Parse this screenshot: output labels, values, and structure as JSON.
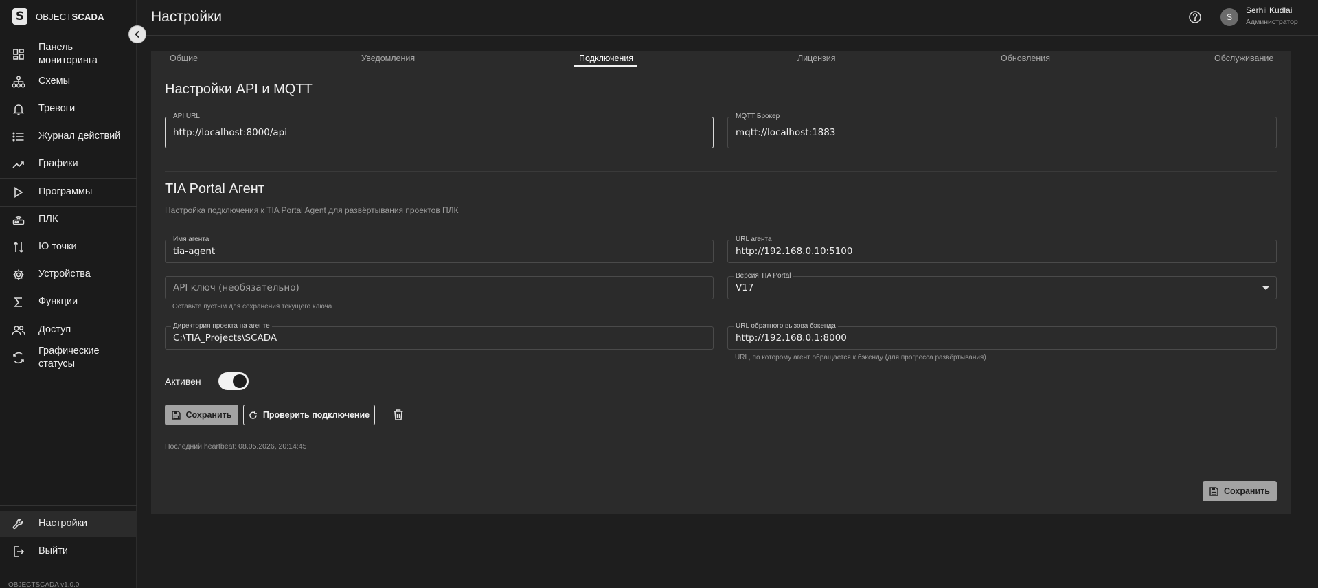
{
  "app": {
    "logo_text_light": "OBJECT",
    "logo_text_bold": "SCADA",
    "version": "OBJECTSCADA v1.0.0"
  },
  "sidebar": {
    "items": [
      {
        "label_line1": "Панель",
        "label_line2": "мониторинга",
        "icon": "dashboard-icon"
      },
      {
        "label": "Схемы",
        "icon": "schema-icon"
      },
      {
        "label": "Тревоги",
        "icon": "bell-icon"
      },
      {
        "label": "Журнал действий",
        "icon": "list-icon"
      },
      {
        "label": "Графики",
        "icon": "trend-icon"
      },
      {
        "label": "Программы",
        "icon": "play-icon"
      },
      {
        "label": "ПЛК",
        "icon": "router-icon"
      },
      {
        "label": "IO точки",
        "icon": "io-icon"
      },
      {
        "label": "Устройства",
        "icon": "gear-icon"
      },
      {
        "label": "Функции",
        "icon": "sigma-icon"
      },
      {
        "label": "Доступ",
        "icon": "users-icon"
      },
      {
        "label_line1": "Графические",
        "label_line2": "статусы",
        "icon": "status-icon"
      }
    ],
    "bottom": [
      {
        "label": "Настройки",
        "icon": "wrench-icon"
      },
      {
        "label": "Выйти",
        "icon": "logout-icon"
      }
    ]
  },
  "header": {
    "title": "Настройки",
    "user_initial": "S",
    "user_name": "Serhii Kudlai",
    "user_role": "Администратор"
  },
  "tabs": [
    {
      "label": "Общие"
    },
    {
      "label": "Уведомления"
    },
    {
      "label": "Подключения"
    },
    {
      "label": "Лицензия"
    },
    {
      "label": "Обновления"
    },
    {
      "label": "Обслуживание"
    }
  ],
  "api_section": {
    "title": "Настройки API и MQTT",
    "api_url_label": "API URL",
    "api_url_value": "http://localhost:8000/api",
    "mqtt_label": "MQTT Брокер",
    "mqtt_value": "mqtt://localhost:1883"
  },
  "tia_section": {
    "title": "TIA Portal Агент",
    "description": "Настройка подключения к TIA Portal Agent для развёртывания проектов ПЛК",
    "agent_name_label": "Имя агента",
    "agent_name_value": "tia-agent",
    "agent_url_label": "URL агента",
    "agent_url_value": "http://192.168.0.10:5100",
    "api_key_placeholder": "API ключ (необязательно)",
    "api_key_helper": "Оставьте пустым для сохранения текущего ключа",
    "tia_version_label": "Версия TIA Portal",
    "tia_version_value": "V17",
    "project_dir_label": "Директория проекта на агенте",
    "project_dir_value": "C:\\TIA_Projects\\SCADA",
    "callback_url_label": "URL обратного вызова бэкенда",
    "callback_url_value": "http://192.168.0.1:8000",
    "callback_url_helper": "URL, по которому агент обращается к бэкенду (для прогресса развёртывания)",
    "active_label": "Активен",
    "active": true,
    "save_label": "Сохранить",
    "test_label": "Проверить подключение",
    "heartbeat": "Последний heartbeat: 08.05.2026, 20:14:45"
  },
  "footer": {
    "save_label": "Сохранить"
  }
}
